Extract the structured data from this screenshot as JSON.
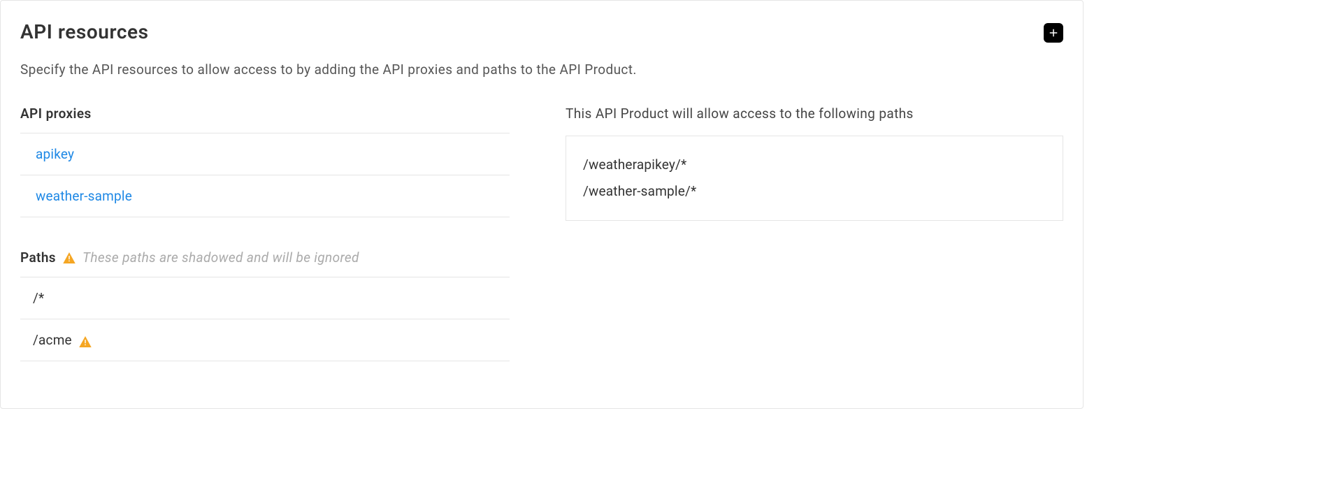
{
  "header": {
    "title": "API resources",
    "description": "Specify the API resources to allow access to by adding the API proxies and paths to the API Product."
  },
  "proxies": {
    "heading": "API proxies",
    "items": [
      {
        "name": "apikey"
      },
      {
        "name": "weather-sample"
      }
    ]
  },
  "paths": {
    "heading": "Paths",
    "warning_note": "These paths are shadowed and will be ignored",
    "items": [
      {
        "path": "/*",
        "warn": false
      },
      {
        "path": "/acme",
        "warn": true
      }
    ]
  },
  "allowed": {
    "heading": "This API Product will allow access to the following paths",
    "items": [
      "/weatherapikey/*",
      "/weather-sample/*"
    ]
  }
}
